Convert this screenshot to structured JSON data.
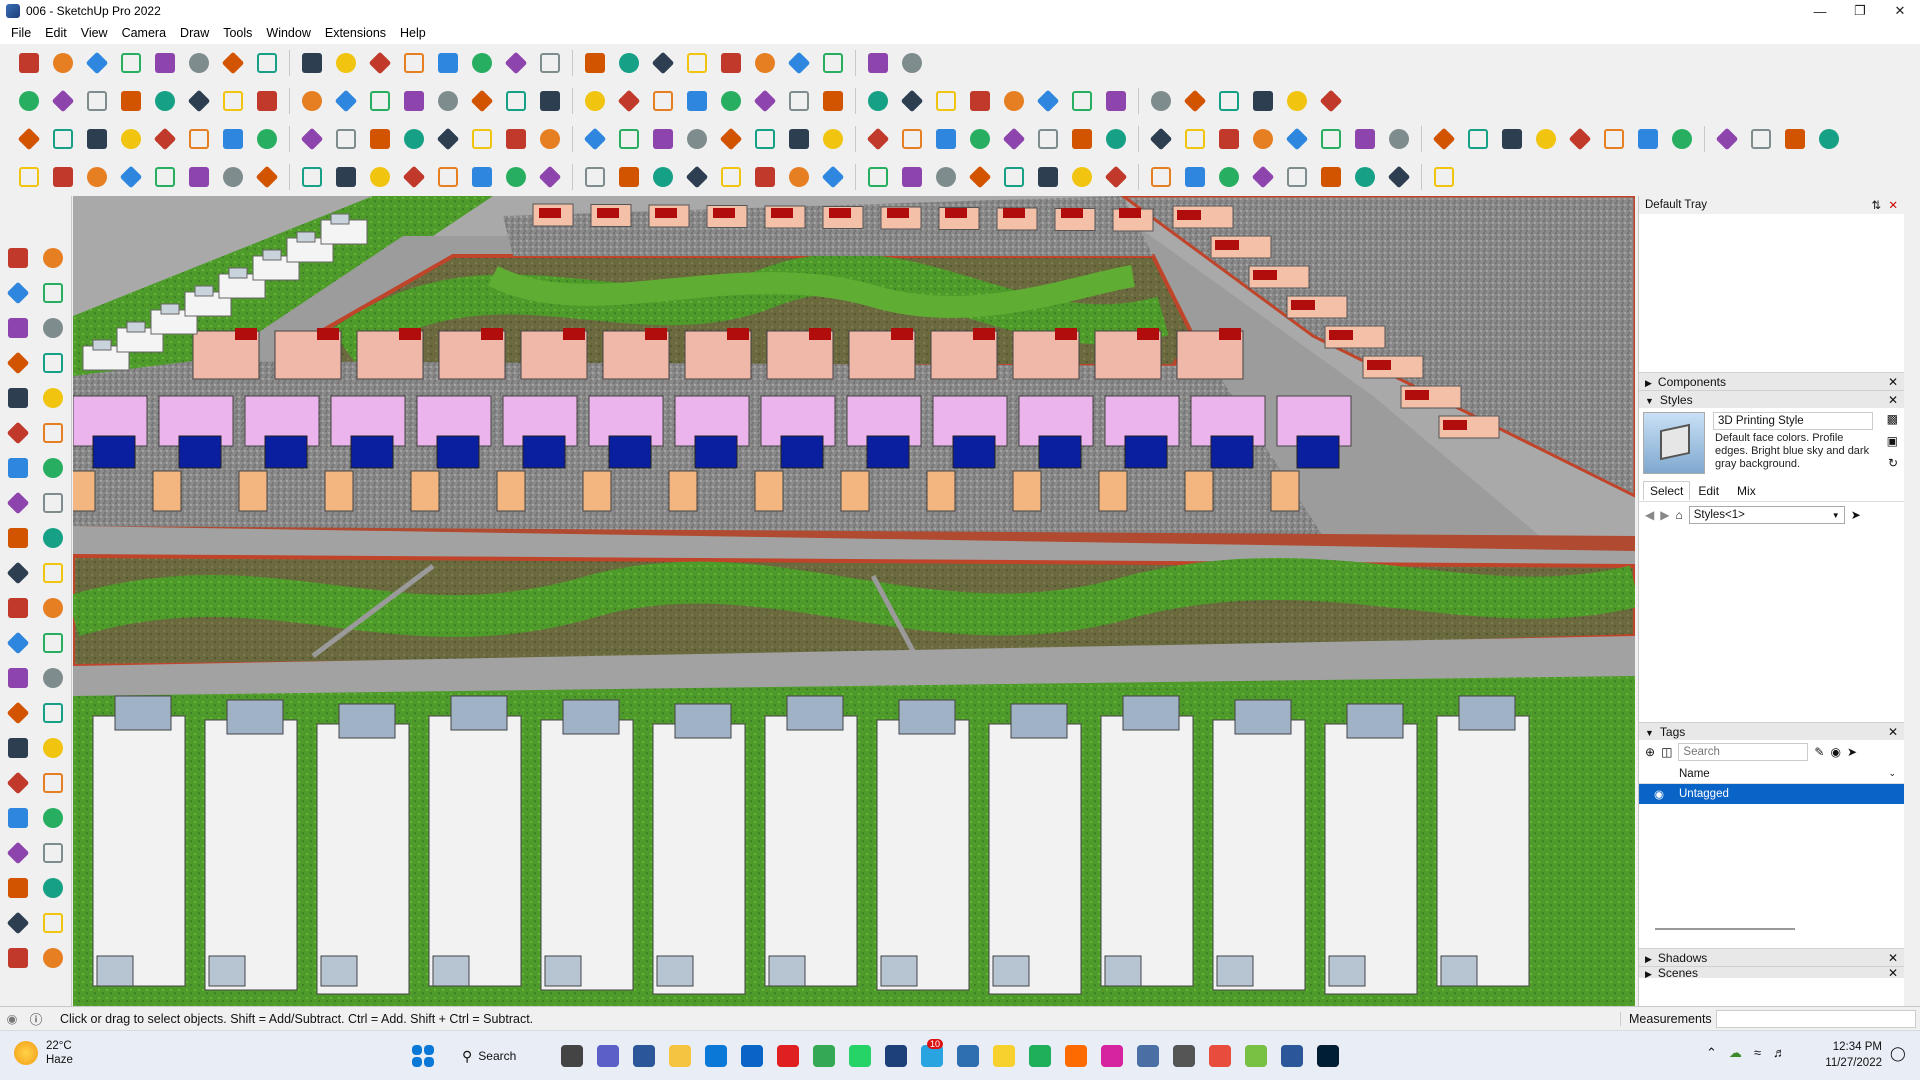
{
  "window": {
    "title": "006 - SketchUp Pro 2022"
  },
  "menu": [
    "File",
    "Edit",
    "View",
    "Camera",
    "Draw",
    "Tools",
    "Window",
    "Extensions",
    "Help"
  ],
  "tray": {
    "title": "Default Tray",
    "components_label": "Components",
    "styles_label": "Styles",
    "style_name": "3D Printing Style",
    "style_desc": "Default face colors. Profile edges. Bright blue sky and dark gray background.",
    "style_tabs": [
      "Select",
      "Edit",
      "Mix"
    ],
    "style_dropdown": "Styles<1>",
    "tags_label": "Tags",
    "tags_search_placeholder": "Search",
    "tags_col_name": "Name",
    "tags_row": "Untagged",
    "shadows_label": "Shadows",
    "scenes_label": "Scenes"
  },
  "status": {
    "hint": "Click or drag to select objects. Shift = Add/Subtract. Ctrl = Add. Shift + Ctrl = Subtract.",
    "measurements_label": "Measurements"
  },
  "taskbar": {
    "weather_temp": "22°C",
    "weather_cond": "Haze",
    "search_label": "Search",
    "whatsapp_badge": "10",
    "time": "12:34 PM",
    "date": "11/27/2022"
  },
  "colors": {
    "accent": "#0a64c8",
    "selection": "#0078d7",
    "roof_red": "#b10d0d",
    "house_pink": "#f0b8a8",
    "house_lilac": "#ecb4ec",
    "house_blue": "#0a1fa0",
    "lawn_green": "#4f9a2c"
  }
}
